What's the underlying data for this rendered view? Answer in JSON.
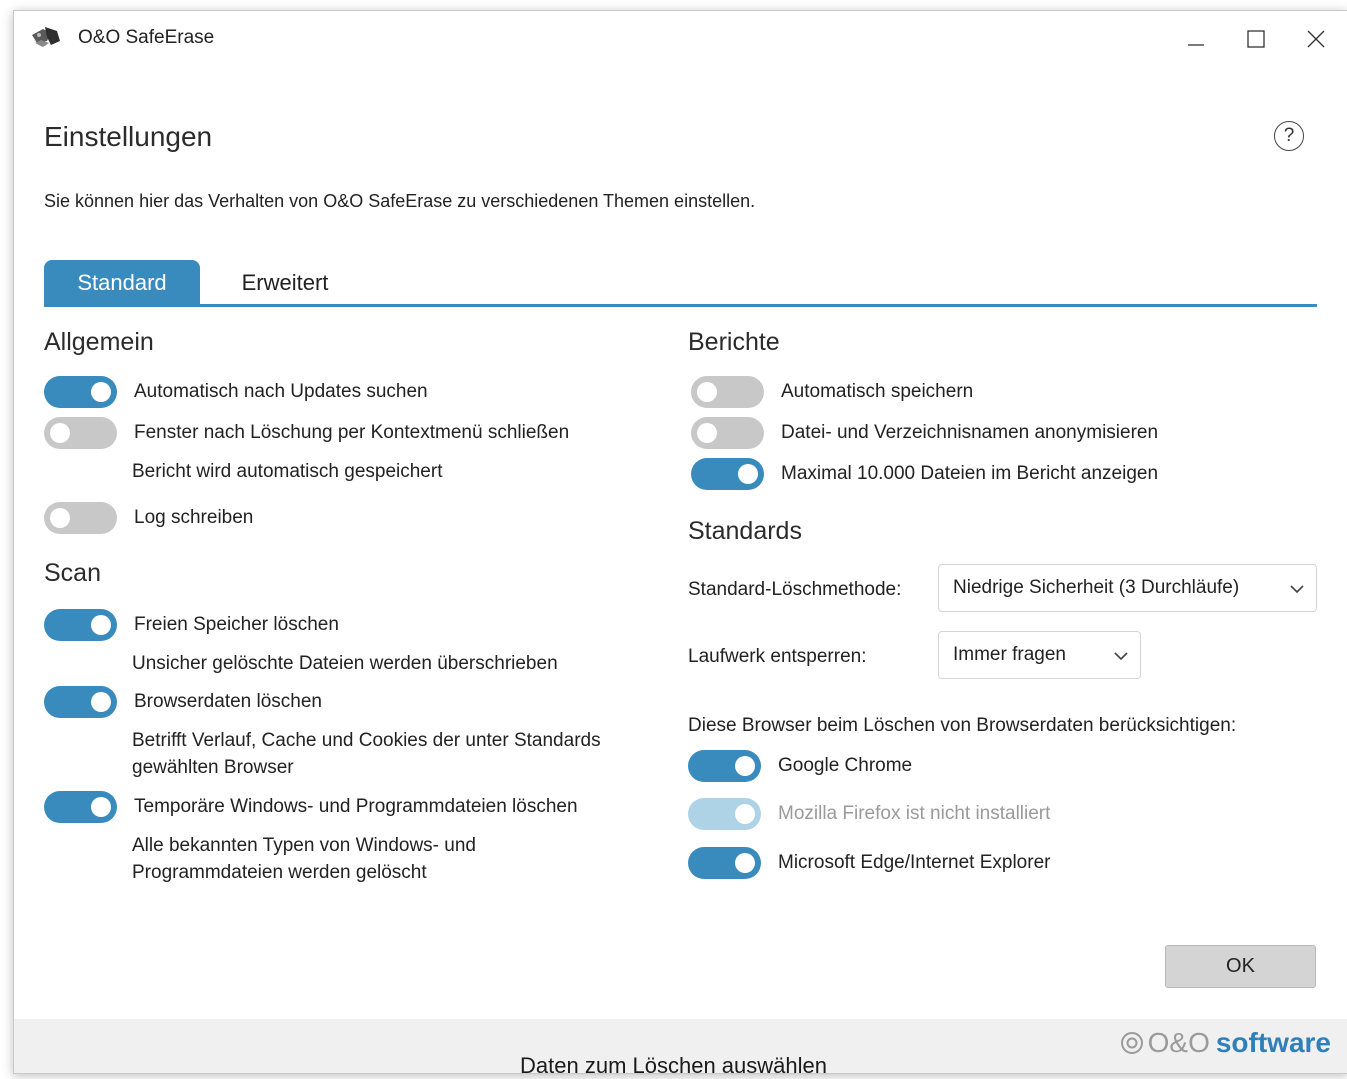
{
  "window": {
    "title": "O&O SafeErase",
    "minimize_icon": "minimize-icon",
    "maximize_icon": "maximize-icon",
    "close_icon": "close-icon"
  },
  "header": {
    "title": "Einstellungen",
    "help_label": "?",
    "description": "Sie können hier das Verhalten von O&O SafeErase zu verschiedenen Themen einstellen."
  },
  "tabs": [
    {
      "label": "Standard",
      "active": true
    },
    {
      "label": "Erweitert",
      "active": false
    }
  ],
  "allgemein": {
    "heading": "Allgemein",
    "auto_updates": {
      "label": "Automatisch nach Updates suchen",
      "on": true
    },
    "close_window": {
      "label": "Fenster nach Löschung per Kontextmenü schließen",
      "on": false
    },
    "report_note": "Bericht wird automatisch gespeichert",
    "log": {
      "label": "Log schreiben",
      "on": false
    }
  },
  "scan": {
    "heading": "Scan",
    "free_space": {
      "label": "Freien Speicher löschen",
      "on": true,
      "note": "Unsicher gelöschte Dateien werden überschrieben"
    },
    "browser_data": {
      "label": "Browserdaten löschen",
      "on": true,
      "note1": "Betrifft Verlauf, Cache und Cookies der unter Standards",
      "note2": "gewählten Browser"
    },
    "temp_files": {
      "label": "Temporäre Windows- und Programmdateien löschen",
      "on": true,
      "note1": "Alle bekannten Typen von Windows- und",
      "note2": "Programmdateien werden gelöscht"
    }
  },
  "berichte": {
    "heading": "Berichte",
    "auto_save": {
      "label": "Automatisch speichern",
      "on": false
    },
    "anonymize": {
      "label": "Datei- und Verzeichnisnamen anonymisieren",
      "on": false
    },
    "max_files": {
      "label": "Maximal 10.000 Dateien im Bericht anzeigen",
      "on": true
    }
  },
  "standards": {
    "heading": "Standards",
    "method_label": "Standard-Löschmethode:",
    "method_value": "Niedrige Sicherheit (3 Durchläufe)",
    "unlock_label": "Laufwerk entsperren:",
    "unlock_value": "Immer fragen",
    "browsers_label": "Diese Browser beim Löschen von Browserdaten berücksichtigen:",
    "chrome": {
      "label": "Google Chrome",
      "on": true
    },
    "firefox": {
      "label": "Mozilla Firefox ist nicht installiert",
      "on": true,
      "disabled": true
    },
    "edge": {
      "label": "Microsoft Edge/Internet Explorer",
      "on": true
    }
  },
  "buttons": {
    "ok": "OK"
  },
  "footer": {
    "brand_prefix": "O&O",
    "brand_suffix": "software"
  },
  "caption": "Daten zum Löschen auswählen",
  "colors": {
    "accent": "#3a8bbd",
    "toggle_off": "#c8c8c8",
    "toggle_disabled": "#aed2e6",
    "brand_blue": "#2f7fb8"
  }
}
